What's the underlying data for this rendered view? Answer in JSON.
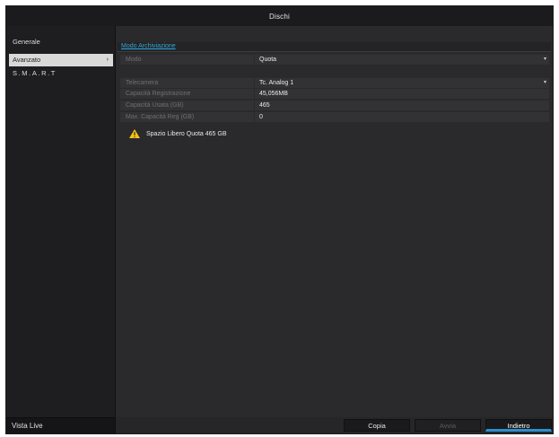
{
  "window": {
    "title": "Dischi"
  },
  "sidebar": {
    "items": [
      {
        "label": "Generale"
      },
      {
        "label": "Avanzato",
        "chevron": "›"
      },
      {
        "label": "S.M.A.R.T"
      }
    ],
    "bottom_label": "Vista Live"
  },
  "tab": {
    "label": "Modo Archiviazione"
  },
  "form": {
    "mode": {
      "label": "Modo",
      "value": "Quota"
    },
    "camera": {
      "label": "Telecamera",
      "value": "Tc. Analog 1"
    },
    "record_capacity": {
      "label": "Capacità Registrazione",
      "value": "45,056MB"
    },
    "used_capacity": {
      "label": "Capacità Usata (GB)",
      "value": "465"
    },
    "max_capacity": {
      "label": "Max. Capacità Reg (GB)",
      "value": "0"
    }
  },
  "warning": {
    "text": "Spazio Libero Quota 465 GB"
  },
  "buttons": {
    "copy": "Copia",
    "apply": "Avvia",
    "back": "Indietro"
  },
  "colors": {
    "accent": "#2d8fd0",
    "link": "#2fa6d8",
    "warning": "#f2c21a"
  }
}
